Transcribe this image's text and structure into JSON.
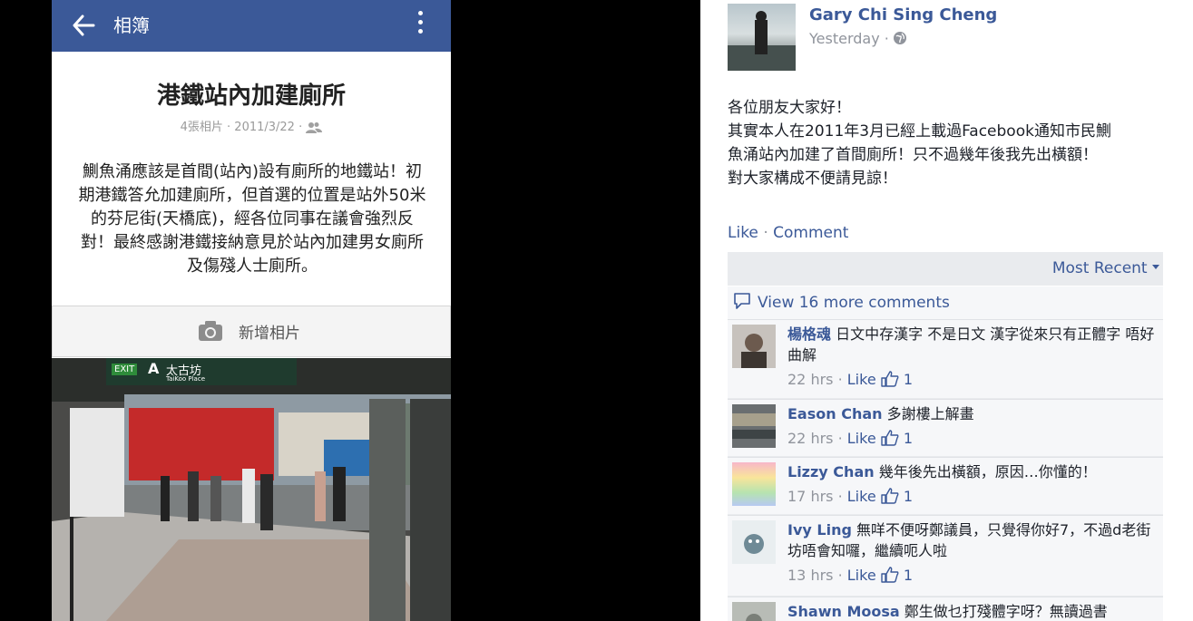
{
  "album": {
    "header_title": "相簿",
    "title": "港鐵站內加建廁所",
    "meta": "4張相片 · 2011/3/22 ·",
    "description": "鰂魚涌應該是首間(站內)設有廁所的地鐵站！初期港鐵答允加建廁所，但首選的位置是站外50米的芬尼街(天橋底)，經各位同事在議會強烈反對！最終感謝港鐵接納意見於站內加建男女廁所及傷殘人士廁所。",
    "add_photo_label": "新增相片",
    "sign": {
      "exit": "EXIT",
      "letter": "A",
      "place_zh": "太古坊",
      "place_en": "TaiKoo Place"
    }
  },
  "post": {
    "author": "Gary Chi Sing Cheng",
    "time": "Yesterday ·",
    "text_lines": [
      "各位朋友大家好！",
      "其實本人在2011年3月已經上載過Facebook通知市民鰂",
      "魚涌站內加建了首間廁所！只不過幾年後我先出橫額！",
      "對大家構成不便請見諒！"
    ],
    "like_label": "Like",
    "comment_label": "Comment",
    "sort_label": "Most Recent",
    "view_more": "View 16 more comments",
    "comments": [
      {
        "name": "楊格魂",
        "text": "日文中存漢字 不是日文 漢字從來只有正體字 唔好曲解",
        "time": "22 hrs",
        "like": "Like",
        "count": "1"
      },
      {
        "name": "Eason Chan",
        "text": "多謝樓上解畫",
        "time": "22 hrs",
        "like": "Like",
        "count": "1"
      },
      {
        "name": "Lizzy Chan",
        "text": "幾年後先出橫額，原因…你懂的！",
        "time": "17 hrs",
        "like": "Like",
        "count": "1"
      },
      {
        "name": "Ivy Ling",
        "text": "無咩不便呀鄭議員，只覺得你好7，不過d老街坊唔會知囉，繼續呃人啦",
        "time": "13 hrs",
        "like": "Like",
        "count": "1"
      },
      {
        "name": "Shawn Moosa",
        "text": "鄭生做乜打殘體字呀？無讀過書",
        "time": "",
        "like": "",
        "count": ""
      }
    ],
    "colors": {
      "brand": "#3b5998",
      "link": "#3b5998",
      "muted": "#90949c"
    }
  }
}
